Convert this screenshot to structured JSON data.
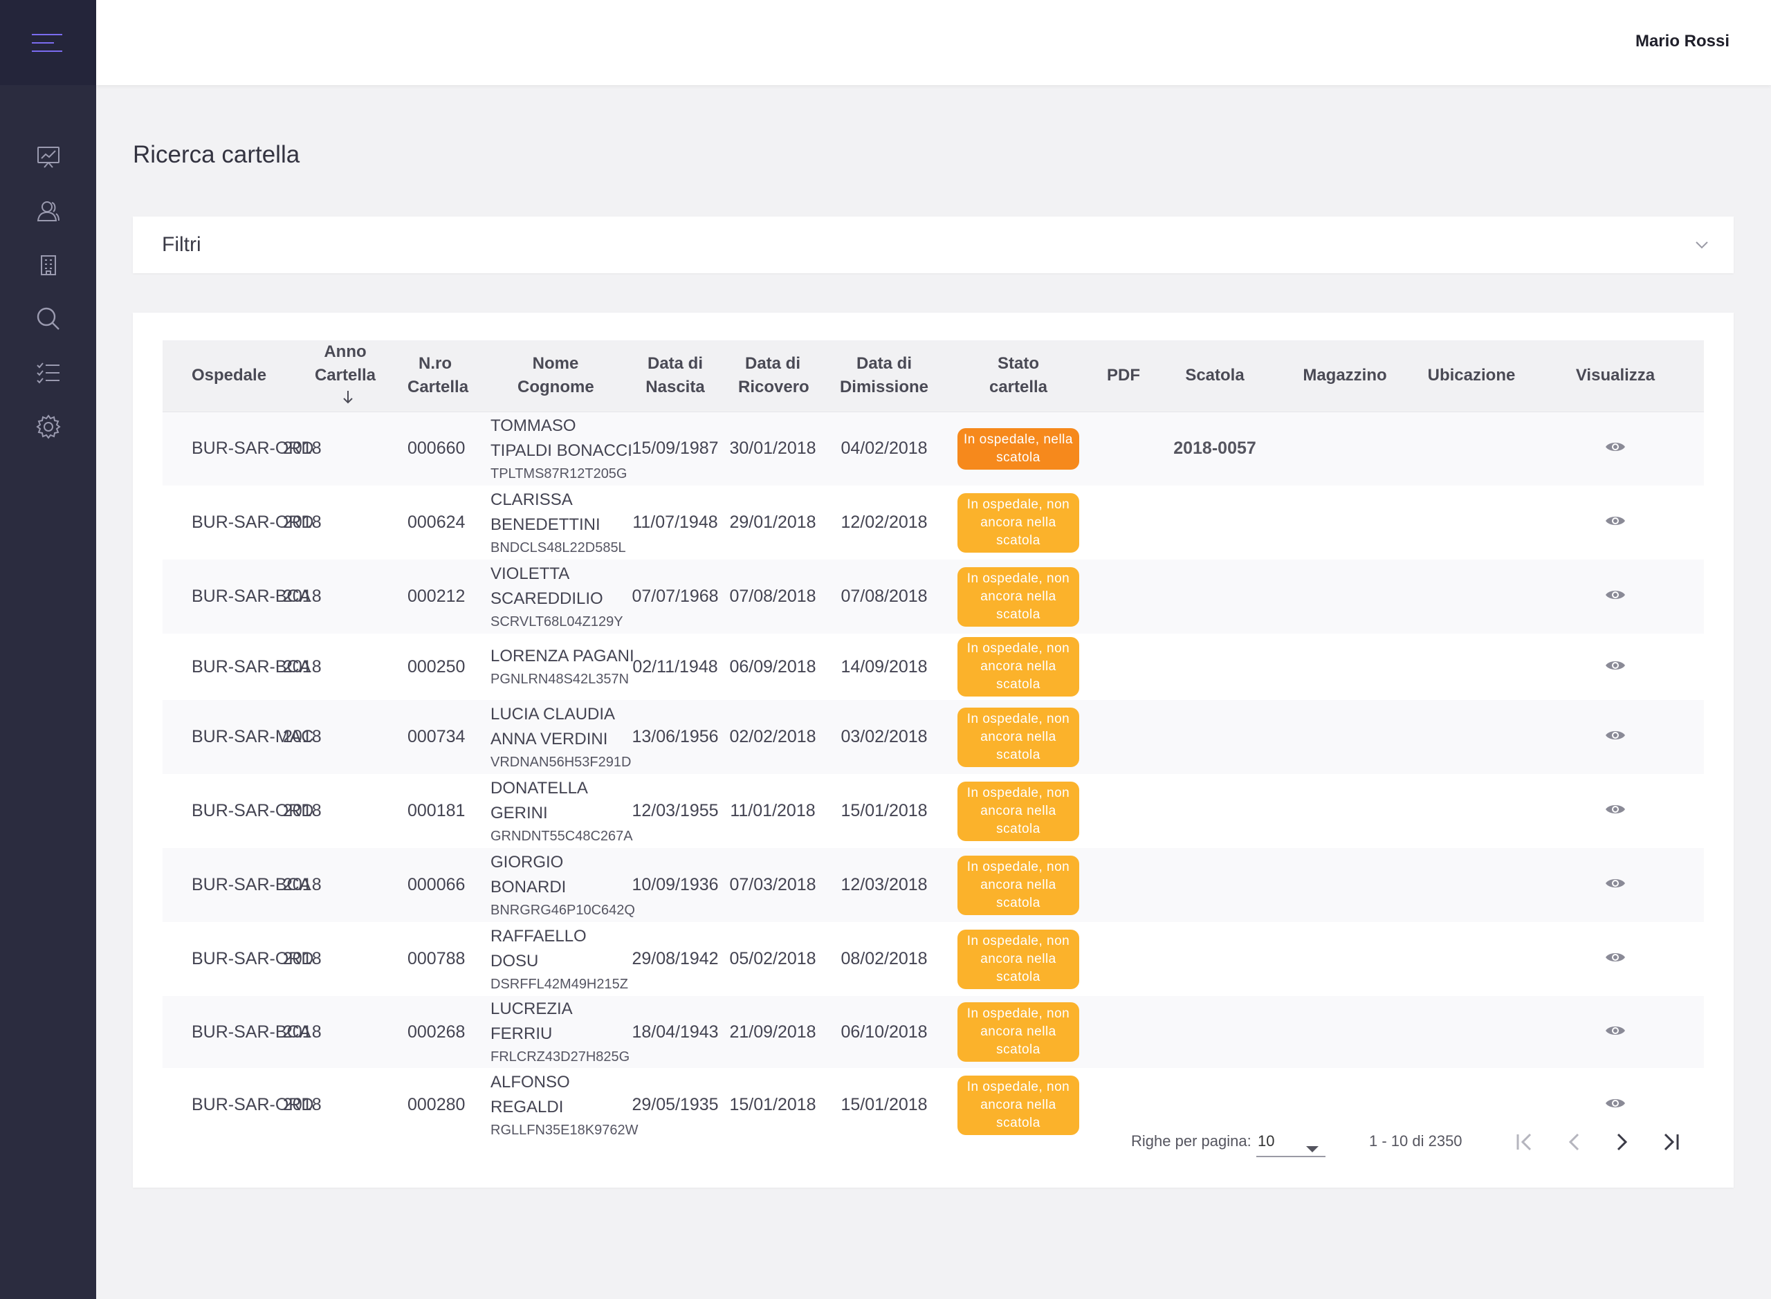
{
  "user": {
    "name": "Mario Rossi"
  },
  "page": {
    "title": "Ricerca cartella"
  },
  "filters": {
    "label": "Filtri"
  },
  "table": {
    "headers": {
      "ospedale": "Ospedale",
      "anno": "Anno Cartella",
      "nro": "N.ro Cartella",
      "nome": "Nome Cognome",
      "nascita": "Data di Nascita",
      "ricovero": "Data di Ricovero",
      "dimissione": "Data di Dimissione",
      "stato": "Stato cartella",
      "pdf": "PDF",
      "scatola": "Scatola",
      "magazzino": "Magazzino",
      "ubicazione": "Ubicazione",
      "visualizza": "Visualizza"
    },
    "rows": [
      {
        "ospedale": "BUR-SAR-ORD",
        "anno": "2018",
        "nro": "000660",
        "nome": "TOMMASO TIPALDI BONACCI",
        "cf": "TPLTMS87R12T205G",
        "nascita": "15/09/1987",
        "ricovero": "30/01/2018",
        "dimissione": "04/02/2018",
        "stato": "In ospedale, nella scatola",
        "scatola": "2018-0057"
      },
      {
        "ospedale": "BUR-SAR-ORD",
        "anno": "2018",
        "nro": "000624",
        "nome": "CLARISSA BENEDETTINI",
        "cf": "BNDCLS48L22D585L",
        "nascita": "11/07/1948",
        "ricovero": "29/01/2018",
        "dimissione": "12/02/2018",
        "stato": "In ospedale, non ancora nella scatola",
        "scatola": ""
      },
      {
        "ospedale": "BUR-SAR-BCA",
        "anno": "2018",
        "nro": "000212",
        "nome": "VIOLETTA SCAREDDILIO",
        "cf": "SCRVLT68L04Z129Y",
        "nascita": "07/07/1968",
        "ricovero": "07/08/2018",
        "dimissione": "07/08/2018",
        "stato": "In ospedale, non ancora nella scatola",
        "scatola": ""
      },
      {
        "ospedale": "BUR-SAR-BCA",
        "anno": "2018",
        "nro": "000250",
        "nome": "LORENZA PAGANI",
        "cf": "PGNLRN48S42L357N",
        "nascita": "02/11/1948",
        "ricovero": "06/09/2018",
        "dimissione": "14/09/2018",
        "stato": "In ospedale, non ancora nella scatola",
        "scatola": ""
      },
      {
        "ospedale": "BUR-SAR-MAC",
        "anno": "2018",
        "nro": "000734",
        "nome": "LUCIA CLAUDIA ANNA VERDINI",
        "cf": "VRDNAN56H53F291D",
        "nascita": "13/06/1956",
        "ricovero": "02/02/2018",
        "dimissione": "03/02/2018",
        "stato": "In ospedale, non ancora nella scatola",
        "scatola": ""
      },
      {
        "ospedale": "BUR-SAR-ORD",
        "anno": "2018",
        "nro": "000181",
        "nome": "DONATELLA GERINI",
        "cf": "GRNDNT55C48C267A",
        "nascita": "12/03/1955",
        "ricovero": "11/01/2018",
        "dimissione": "15/01/2018",
        "stato": "In ospedale, non ancora nella scatola",
        "scatola": ""
      },
      {
        "ospedale": "BUR-SAR-BCA",
        "anno": "2018",
        "nro": "000066",
        "nome": "GIORGIO BONARDI",
        "cf": "BNRGRG46P10C642Q",
        "nascita": "10/09/1936",
        "ricovero": "07/03/2018",
        "dimissione": "12/03/2018",
        "stato": "In ospedale, non ancora nella scatola",
        "scatola": ""
      },
      {
        "ospedale": "BUR-SAR-ORD",
        "anno": "2018",
        "nro": "000788",
        "nome": "RAFFAELLO DOSU",
        "cf": "DSRFFL42M49H215Z",
        "nascita": "29/08/1942",
        "ricovero": "05/02/2018",
        "dimissione": "08/02/2018",
        "stato": "In ospedale, non ancora nella scatola",
        "scatola": ""
      },
      {
        "ospedale": "BUR-SAR-BCA",
        "anno": "2018",
        "nro": "000268",
        "nome": "LUCREZIA FERRIU",
        "cf": "FRLCRZ43D27H825G",
        "nascita": "18/04/1943",
        "ricovero": "21/09/2018",
        "dimissione": "06/10/2018",
        "stato": "In ospedale, non ancora nella scatola",
        "scatola": ""
      },
      {
        "ospedale": "BUR-SAR-ORD",
        "anno": "2018",
        "nro": "000280",
        "nome": "ALFONSO REGALDI",
        "cf": "RGLLFN35E18K9762W",
        "nascita": "29/05/1935",
        "ricovero": "15/01/2018",
        "dimissione": "15/01/2018",
        "stato": "In ospedale, non ancora nella scatola",
        "scatola": ""
      }
    ]
  },
  "pagination": {
    "rows_per_page_label": "Righe per pagina:",
    "rows_per_page_value": "10",
    "range_text": "1 - 10 di 2350"
  },
  "colors": {
    "sidebar": "#2b2c3f",
    "accent": "#7b6cf0",
    "badge_in_box": "#f6891c",
    "badge_not_in_box": "#fbb22b"
  },
  "icons": {
    "sidebar": [
      "menu-icon",
      "chart-icon",
      "users-icon",
      "building-icon",
      "search-icon",
      "checklist-icon",
      "gear-icon"
    ],
    "row_action": "eye-icon"
  }
}
